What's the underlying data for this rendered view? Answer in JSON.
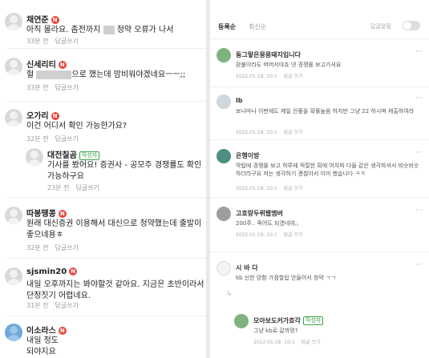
{
  "left": {
    "comments": [
      {
        "nick": "채연준",
        "badge": "N",
        "text_before": "아직 몰라요. 좀전까지 ",
        "text_after": " 청약 오류가 나서",
        "time": "33분 전",
        "reply": "답글쓰기"
      },
      {
        "nick": "신세리티",
        "badge": "N",
        "text_before": "헐 ",
        "text_after": "으로 했는데 맘비워야겠네요ㅡㅡ;;",
        "time": "33분 전",
        "reply": "답글쓰기"
      },
      {
        "nick": "오가리",
        "badge": "N",
        "text": "이건 어디서 확인 가능한가요?",
        "time": "32분 전",
        "reply": "답글쓰기"
      },
      {
        "nick": "대전칠곰",
        "writer": "작성자",
        "text": "기사를 봤어요! 증권사 - 공모주 경쟁률도 확인가능하구요",
        "time": "23분 전",
        "reply": "답글쓰기"
      },
      {
        "nick": "따봉땡콩",
        "badge": "N",
        "text": "원래 대신증권 이용해서 대신으로 청약했는데 출발이 좋으네용ㅎ",
        "time": "32분 전",
        "reply": "답글쓰기"
      },
      {
        "nick": "sjsmin20",
        "badge": "N",
        "text": "내일 오후까지는 봐야할것 같아요. 지금은 초반이라서 단정짓기 어렵네요.",
        "time": "31분 전",
        "reply": "답글쓰기"
      },
      {
        "nick": "이소라스",
        "badge": "N",
        "text": "내일 정도 되야지요",
        "time": "",
        "reply": ""
      }
    ]
  },
  "right": {
    "tabs": [
      "등록순",
      "최신순"
    ],
    "toggle_label": "답글알림",
    "more_glyph": "···",
    "reply_arrow": "↳",
    "comments": [
      {
        "nick": "동그랗은뭉뭉돼지입니다",
        "text": "환불이라도 머머서야죠 넷 경쟁률 보고가셔요",
        "time": "2022.01.18. 10:1",
        "reply": "답글 쓰기"
      },
      {
        "nick": "lb",
        "text": "보나마나 이번에도 제일 안좋을 확률높음 하지만 그냥 22 하시며 제출하여라",
        "time": "2022.01.18. 10:1",
        "reply": "답글 쓰기"
      },
      {
        "nick": "은행이방",
        "text": "막탑에 경쟁률 보고 하루에 적절한 확에 어차피 다들 같은 생각하셔서 비슷비슷 하더라구요 저는 생각하기 괜찮아서 이미 했습니다 ㅋㅋ",
        "time": "2022.01.18. 10:1",
        "reply": "답글 쓰기"
      },
      {
        "nick": "고호랑두뤼웹멤버",
        "text": "200주.. 죽어도 되겠네여;;",
        "time": "2022.01.18. 10:1",
        "reply": "답글 쓰기"
      },
      {
        "nick": "시 바 다",
        "text": "kb 신한 망함 가점할랍 안들어서 청약 ㄱㄱ",
        "time": "2022.01.18. 10:1",
        "reply": "답글 쓰기"
      },
      {
        "nick": "모아보도커가호각",
        "writer": "작성자",
        "text": "그냥 kb로 갈까멍?",
        "time": "2022.01.18. 10:1",
        "reply": "답글 쓰기"
      }
    ]
  }
}
